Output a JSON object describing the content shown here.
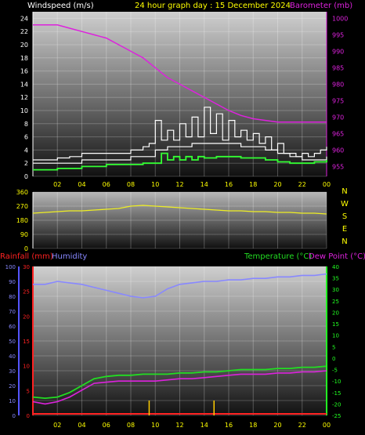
{
  "header": {
    "left_title": "Windspeed (m/s)",
    "center_title": "24 hour graph day : 15 December 2024",
    "right_title": "Barometer (mb)"
  },
  "colors": {
    "wind_avg": "#ffffff",
    "wind_gust": "#ffffff",
    "wind_low": "#33ff33",
    "barometer": "#dd22dd",
    "direction": "#eeee22",
    "rainfall": "#ff2222",
    "humidity": "#8888ff",
    "temperature": "#22dd22",
    "dewpoint": "#dd22dd",
    "title_yellow": "#ffff00",
    "axis_green": "#22ff22"
  },
  "x_ticks": [
    "02",
    "04",
    "06",
    "08",
    "10",
    "12",
    "14",
    "16",
    "18",
    "20",
    "22",
    "00"
  ],
  "chart_data": [
    {
      "type": "line",
      "name": "wind-barometer",
      "x_label_format": "hour",
      "xlim": [
        0,
        24
      ],
      "left_axis": {
        "label": "Windspeed (m/s)",
        "ticks": [
          "0",
          "2",
          "4",
          "6",
          "8",
          "10",
          "12",
          "14",
          "16",
          "18",
          "20",
          "22",
          "24"
        ],
        "ylim": [
          0,
          25
        ]
      },
      "right_axis": {
        "label": "Barometer (mb)",
        "ticks": [
          "955",
          "960",
          "965",
          "970",
          "975",
          "980",
          "985",
          "990",
          "995",
          "1000"
        ],
        "ylim": [
          952,
          1002
        ]
      },
      "series": [
        {
          "name": "Windspeed (m/s)",
          "axis": "left",
          "kind": "gust",
          "x": [
            0,
            1,
            2,
            3,
            4,
            5,
            6,
            7,
            8,
            9,
            9.5,
            10,
            10.5,
            11,
            11.5,
            12,
            12.5,
            13,
            13.5,
            14,
            14.5,
            15,
            15.5,
            16,
            16.5,
            17,
            17.5,
            18,
            18.5,
            19,
            19.5,
            20,
            20.5,
            21,
            21.5,
            22,
            22.5,
            23,
            23.5,
            24
          ],
          "y": [
            2.5,
            2.5,
            2.8,
            3,
            3.5,
            3.5,
            3.5,
            3.5,
            4,
            4.5,
            5,
            8.5,
            5.5,
            7,
            5.5,
            8,
            6,
            9,
            6,
            10.5,
            6.5,
            9.5,
            5.5,
            8.5,
            6,
            7,
            5.5,
            6.5,
            5,
            6,
            4,
            5,
            3.5,
            3.5,
            3,
            3.5,
            3,
            3.5,
            4,
            4.5
          ]
        },
        {
          "name": "avg",
          "axis": "left",
          "kind": "avg",
          "x": [
            0,
            2,
            4,
            6,
            8,
            9,
            10,
            11,
            12,
            13,
            14,
            15,
            16,
            17,
            18,
            19,
            20,
            21,
            22,
            23,
            24
          ],
          "y": [
            2,
            2,
            2.5,
            2.5,
            3,
            3,
            4,
            4.5,
            4.5,
            5,
            5,
            5,
            5,
            4.5,
            4.5,
            4,
            3.5,
            3,
            2.5,
            2.5,
            3
          ]
        },
        {
          "name": "low",
          "axis": "left",
          "kind": "low",
          "x": [
            0,
            1,
            2,
            3,
            4,
            5,
            6,
            7,
            8,
            9,
            10,
            10.5,
            11,
            11.5,
            12,
            12.5,
            13,
            13.5,
            14,
            15,
            16,
            17,
            18,
            19,
            20,
            21,
            22,
            23,
            24
          ],
          "y": [
            1,
            1,
            1.2,
            1.2,
            1.5,
            1.5,
            1.8,
            1.8,
            1.8,
            2,
            2,
            3.5,
            2.5,
            3,
            2.5,
            3,
            2.5,
            3,
            2.8,
            3,
            3,
            2.8,
            2.8,
            2.5,
            2.2,
            2,
            2,
            2.2,
            2.5
          ]
        },
        {
          "name": "Barometer (mb)",
          "axis": "right",
          "kind": "baro",
          "x": [
            0,
            1,
            2,
            3,
            4,
            5,
            6,
            7,
            8,
            9,
            10,
            11,
            12,
            13,
            14,
            15,
            16,
            17,
            18,
            19,
            20,
            21,
            22,
            23,
            24
          ],
          "y": [
            998,
            998,
            998,
            997,
            996,
            995,
            994,
            992,
            990,
            988,
            985,
            982,
            980,
            978,
            976,
            974,
            972,
            970.5,
            969.5,
            969,
            968.5,
            968.5,
            968.5,
            968.5,
            968.5
          ]
        }
      ]
    },
    {
      "type": "line",
      "name": "wind-direction",
      "xlim": [
        0,
        24
      ],
      "left_axis": {
        "ticks": [
          "0",
          "90",
          "180",
          "270",
          "360"
        ],
        "ylim": [
          0,
          360
        ]
      },
      "right_axis": {
        "ticks": [
          "N",
          "W",
          "S",
          "E",
          "N"
        ]
      },
      "series": [
        {
          "name": "direction",
          "x": [
            0,
            1,
            2,
            3,
            4,
            5,
            6,
            7,
            8,
            9,
            10,
            11,
            12,
            13,
            14,
            15,
            16,
            17,
            18,
            19,
            20,
            21,
            22,
            23,
            24
          ],
          "y": [
            225,
            230,
            235,
            240,
            240,
            245,
            250,
            255,
            270,
            275,
            270,
            265,
            260,
            255,
            250,
            245,
            240,
            240,
            235,
            235,
            230,
            230,
            225,
            225,
            220
          ]
        }
      ]
    },
    {
      "type": "line",
      "name": "rain-humidity-temperature",
      "xlim": [
        0,
        24
      ],
      "labels": {
        "rainfall": "Rainfall (mm)",
        "humidity": "Humidity",
        "temperature": "Temperature (°C)",
        "dewpoint": "Dew Point (°C)"
      },
      "humidity_axis": {
        "ticks": [
          "0",
          "10",
          "20",
          "30",
          "40",
          "50",
          "60",
          "70",
          "80",
          "90",
          "100"
        ],
        "ylim": [
          0,
          100
        ]
      },
      "rain_axis": {
        "ticks": [
          "0",
          "5",
          "10",
          "15",
          "20",
          "25",
          "30"
        ],
        "ylim": [
          0,
          30
        ]
      },
      "temp_axis": {
        "ticks": [
          "-25",
          "-20",
          "-15",
          "-10",
          "-5",
          "0",
          "5",
          "10",
          "15",
          "20",
          "25",
          "30",
          "35",
          "40"
        ],
        "ylim": [
          -25,
          40
        ]
      },
      "series": [
        {
          "name": "Humidity",
          "axis": "humidity",
          "x": [
            0,
            1,
            2,
            3,
            4,
            5,
            6,
            7,
            8,
            9,
            10,
            11,
            12,
            13,
            14,
            15,
            16,
            17,
            18,
            19,
            20,
            21,
            22,
            23,
            24
          ],
          "y": [
            88,
            88,
            90,
            89,
            88,
            86,
            84,
            82,
            80,
            79,
            80,
            85,
            88,
            89,
            90,
            90,
            91,
            91,
            92,
            92,
            93,
            93,
            94,
            94,
            95
          ]
        },
        {
          "name": "Temperature",
          "axis": "temp",
          "x": [
            0,
            1,
            2,
            3,
            4,
            5,
            6,
            7,
            8,
            9,
            10,
            11,
            12,
            13,
            14,
            15,
            16,
            17,
            18,
            19,
            20,
            21,
            22,
            23,
            24
          ],
          "y": [
            -17,
            -17.5,
            -17,
            -15,
            -12,
            -9,
            -8,
            -7.5,
            -7.5,
            -7,
            -7,
            -7,
            -6.5,
            -6.5,
            -6,
            -6,
            -5.5,
            -5,
            -5,
            -5,
            -4.5,
            -4.5,
            -4,
            -4,
            -3.5
          ]
        },
        {
          "name": "Dew Point",
          "axis": "temp",
          "x": [
            0,
            1,
            2,
            3,
            4,
            5,
            6,
            7,
            8,
            9,
            10,
            11,
            12,
            13,
            14,
            15,
            16,
            17,
            18,
            19,
            20,
            21,
            22,
            23,
            24
          ],
          "y": [
            -19,
            -20,
            -19,
            -17,
            -14,
            -11,
            -10.5,
            -10,
            -10,
            -10,
            -10,
            -9.5,
            -9,
            -9,
            -8.5,
            -8,
            -7.5,
            -7,
            -7,
            -7,
            -6.5,
            -6.5,
            -6,
            -6,
            -5.5
          ]
        },
        {
          "name": "Rainfall",
          "axis": "rain",
          "kind": "bars",
          "x": [
            9.5,
            14.8
          ],
          "y": [
            3,
            3
          ]
        }
      ]
    }
  ]
}
